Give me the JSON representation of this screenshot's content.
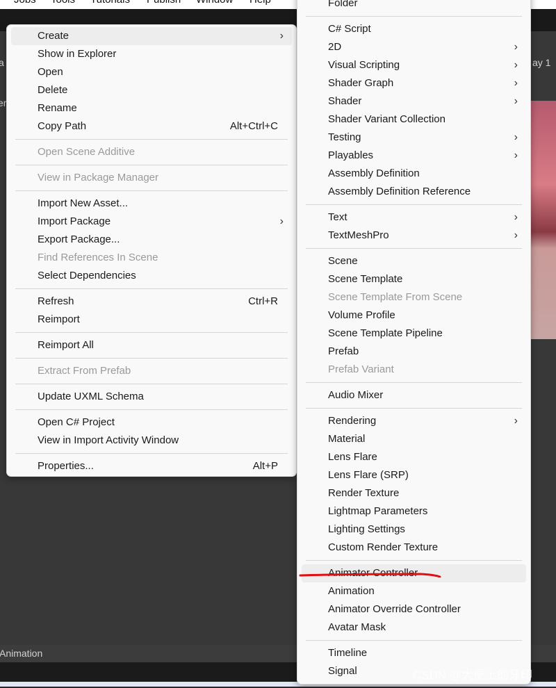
{
  "menubar": [
    "Jobs",
    "Tools",
    "Tutorials",
    "Publish",
    "Window",
    "Help"
  ],
  "background": {
    "frag_left1": "a",
    "frag_left2": "er",
    "frag_right": "ay 1",
    "animation_bar": "Animation"
  },
  "left_menu": [
    {
      "label": "Create",
      "submenu": true,
      "highlighted": true
    },
    {
      "label": "Show in Explorer"
    },
    {
      "label": "Open"
    },
    {
      "label": "Delete"
    },
    {
      "label": "Rename"
    },
    {
      "label": "Copy Path",
      "shortcut": "Alt+Ctrl+C"
    },
    {
      "sep": true
    },
    {
      "label": "Open Scene Additive",
      "disabled": true
    },
    {
      "sep": true
    },
    {
      "label": "View in Package Manager",
      "disabled": true
    },
    {
      "sep": true
    },
    {
      "label": "Import New Asset..."
    },
    {
      "label": "Import Package",
      "submenu": true
    },
    {
      "label": "Export Package..."
    },
    {
      "label": "Find References In Scene",
      "disabled": true
    },
    {
      "label": "Select Dependencies"
    },
    {
      "sep": true
    },
    {
      "label": "Refresh",
      "shortcut": "Ctrl+R"
    },
    {
      "label": "Reimport"
    },
    {
      "sep": true
    },
    {
      "label": "Reimport All"
    },
    {
      "sep": true
    },
    {
      "label": "Extract From Prefab",
      "disabled": true
    },
    {
      "sep": true
    },
    {
      "label": "Update UXML Schema"
    },
    {
      "sep": true
    },
    {
      "label": "Open C# Project"
    },
    {
      "label": "View in Import Activity Window"
    },
    {
      "sep": true
    },
    {
      "label": "Properties...",
      "shortcut": "Alt+P"
    }
  ],
  "right_menu": [
    {
      "label": "Folder"
    },
    {
      "sep": true
    },
    {
      "label": "C# Script"
    },
    {
      "label": "2D",
      "submenu": true
    },
    {
      "label": "Visual Scripting",
      "submenu": true
    },
    {
      "label": "Shader Graph",
      "submenu": true
    },
    {
      "label": "Shader",
      "submenu": true
    },
    {
      "label": "Shader Variant Collection"
    },
    {
      "label": "Testing",
      "submenu": true
    },
    {
      "label": "Playables",
      "submenu": true
    },
    {
      "label": "Assembly Definition"
    },
    {
      "label": "Assembly Definition Reference"
    },
    {
      "sep": true
    },
    {
      "label": "Text",
      "submenu": true
    },
    {
      "label": "TextMeshPro",
      "submenu": true
    },
    {
      "sep": true
    },
    {
      "label": "Scene"
    },
    {
      "label": "Scene Template"
    },
    {
      "label": "Scene Template From Scene",
      "disabled": true
    },
    {
      "label": "Volume Profile"
    },
    {
      "label": "Scene Template Pipeline"
    },
    {
      "label": "Prefab"
    },
    {
      "label": "Prefab Variant",
      "disabled": true
    },
    {
      "sep": true
    },
    {
      "label": "Audio Mixer"
    },
    {
      "sep": true
    },
    {
      "label": "Rendering",
      "submenu": true
    },
    {
      "label": "Material"
    },
    {
      "label": "Lens Flare"
    },
    {
      "label": "Lens Flare (SRP)"
    },
    {
      "label": "Render Texture"
    },
    {
      "label": "Lightmap Parameters"
    },
    {
      "label": "Lighting Settings"
    },
    {
      "label": "Custom Render Texture"
    },
    {
      "sep": true
    },
    {
      "label": "Animator Controller",
      "highlighted": true
    },
    {
      "label": "Animation"
    },
    {
      "label": "Animator Override Controller"
    },
    {
      "label": "Avatar Mask"
    },
    {
      "sep": true
    },
    {
      "label": "Timeline"
    },
    {
      "label": "Signal"
    },
    {
      "sep": true
    }
  ],
  "submenu_arrow": "›",
  "annotation_color": "#e01010",
  "watermark": "CSDN @大便上的牙印"
}
